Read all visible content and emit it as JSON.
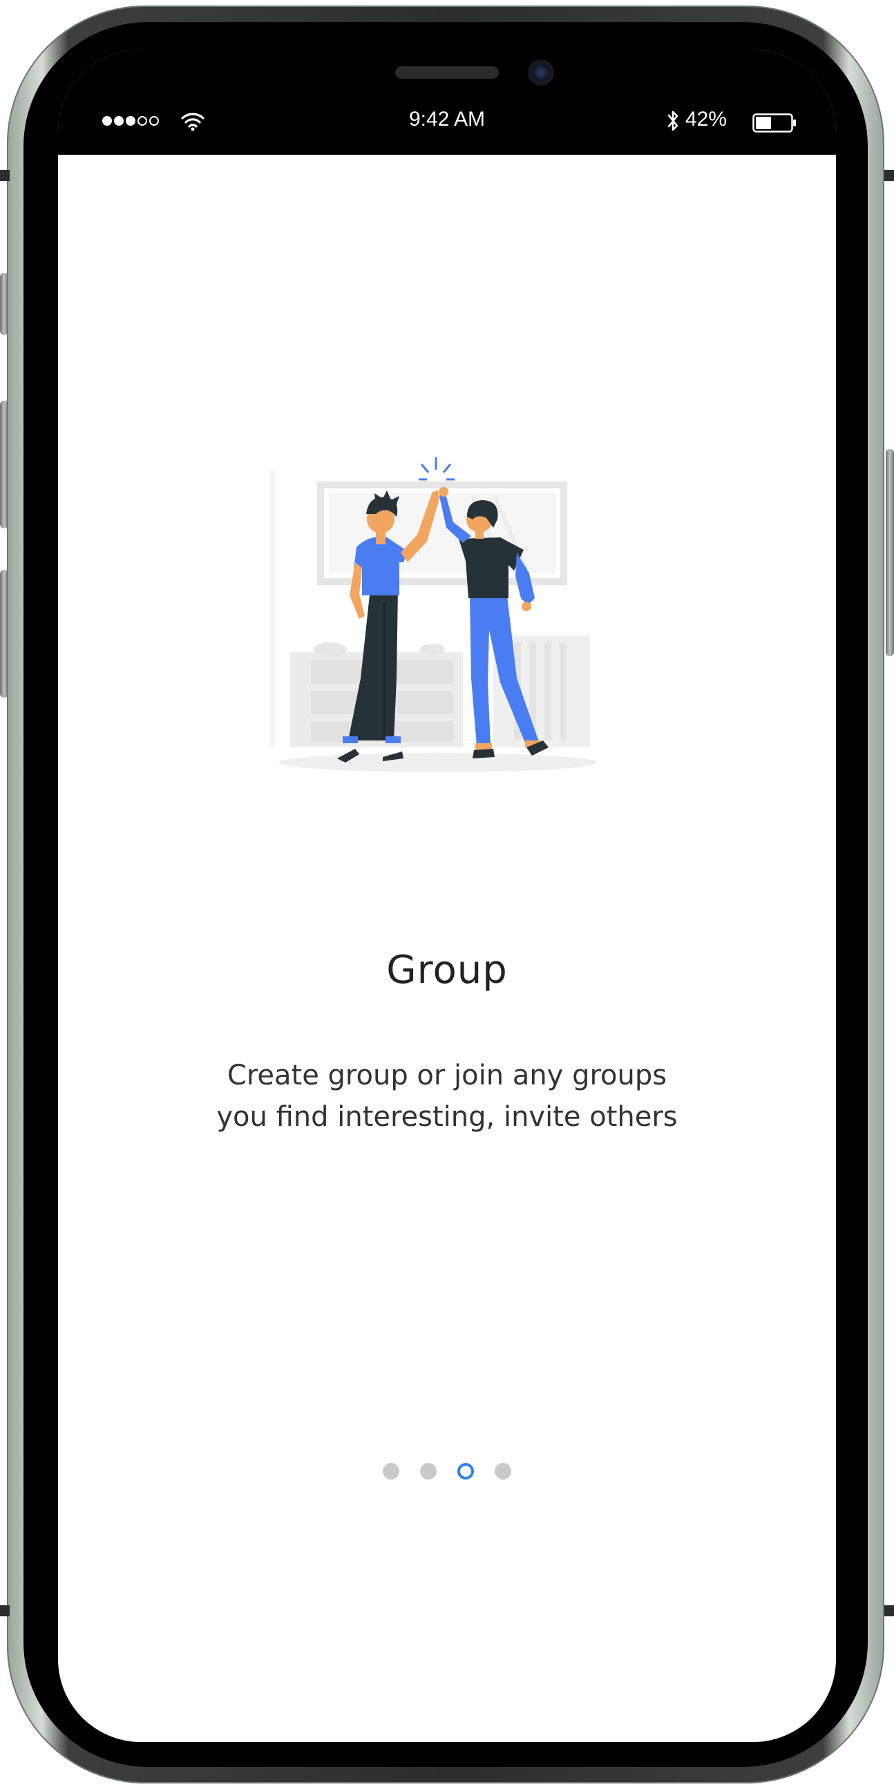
{
  "status_bar": {
    "time": "9:42 AM",
    "battery_percent": "42%",
    "signal_bars_filled": 3,
    "signal_bars_total": 5
  },
  "onboarding": {
    "title": "Group",
    "description_line1": "Create group or join any groups",
    "description_line2": "you find interesting, invite others",
    "illustration": "two-people-high-five-illustration"
  },
  "pager": {
    "total": 4,
    "active_index": 2
  },
  "colors": {
    "accent": "#2f80ed",
    "illustration_blue": "#4a7cf2",
    "inactive_dot": "#c9c9c9",
    "title_text": "#222222",
    "body_text": "#333333"
  },
  "icons": {
    "wifi": "wifi-icon",
    "bluetooth": "bluetooth-icon",
    "battery": "battery-icon",
    "signal": "signal-dots-icon"
  }
}
